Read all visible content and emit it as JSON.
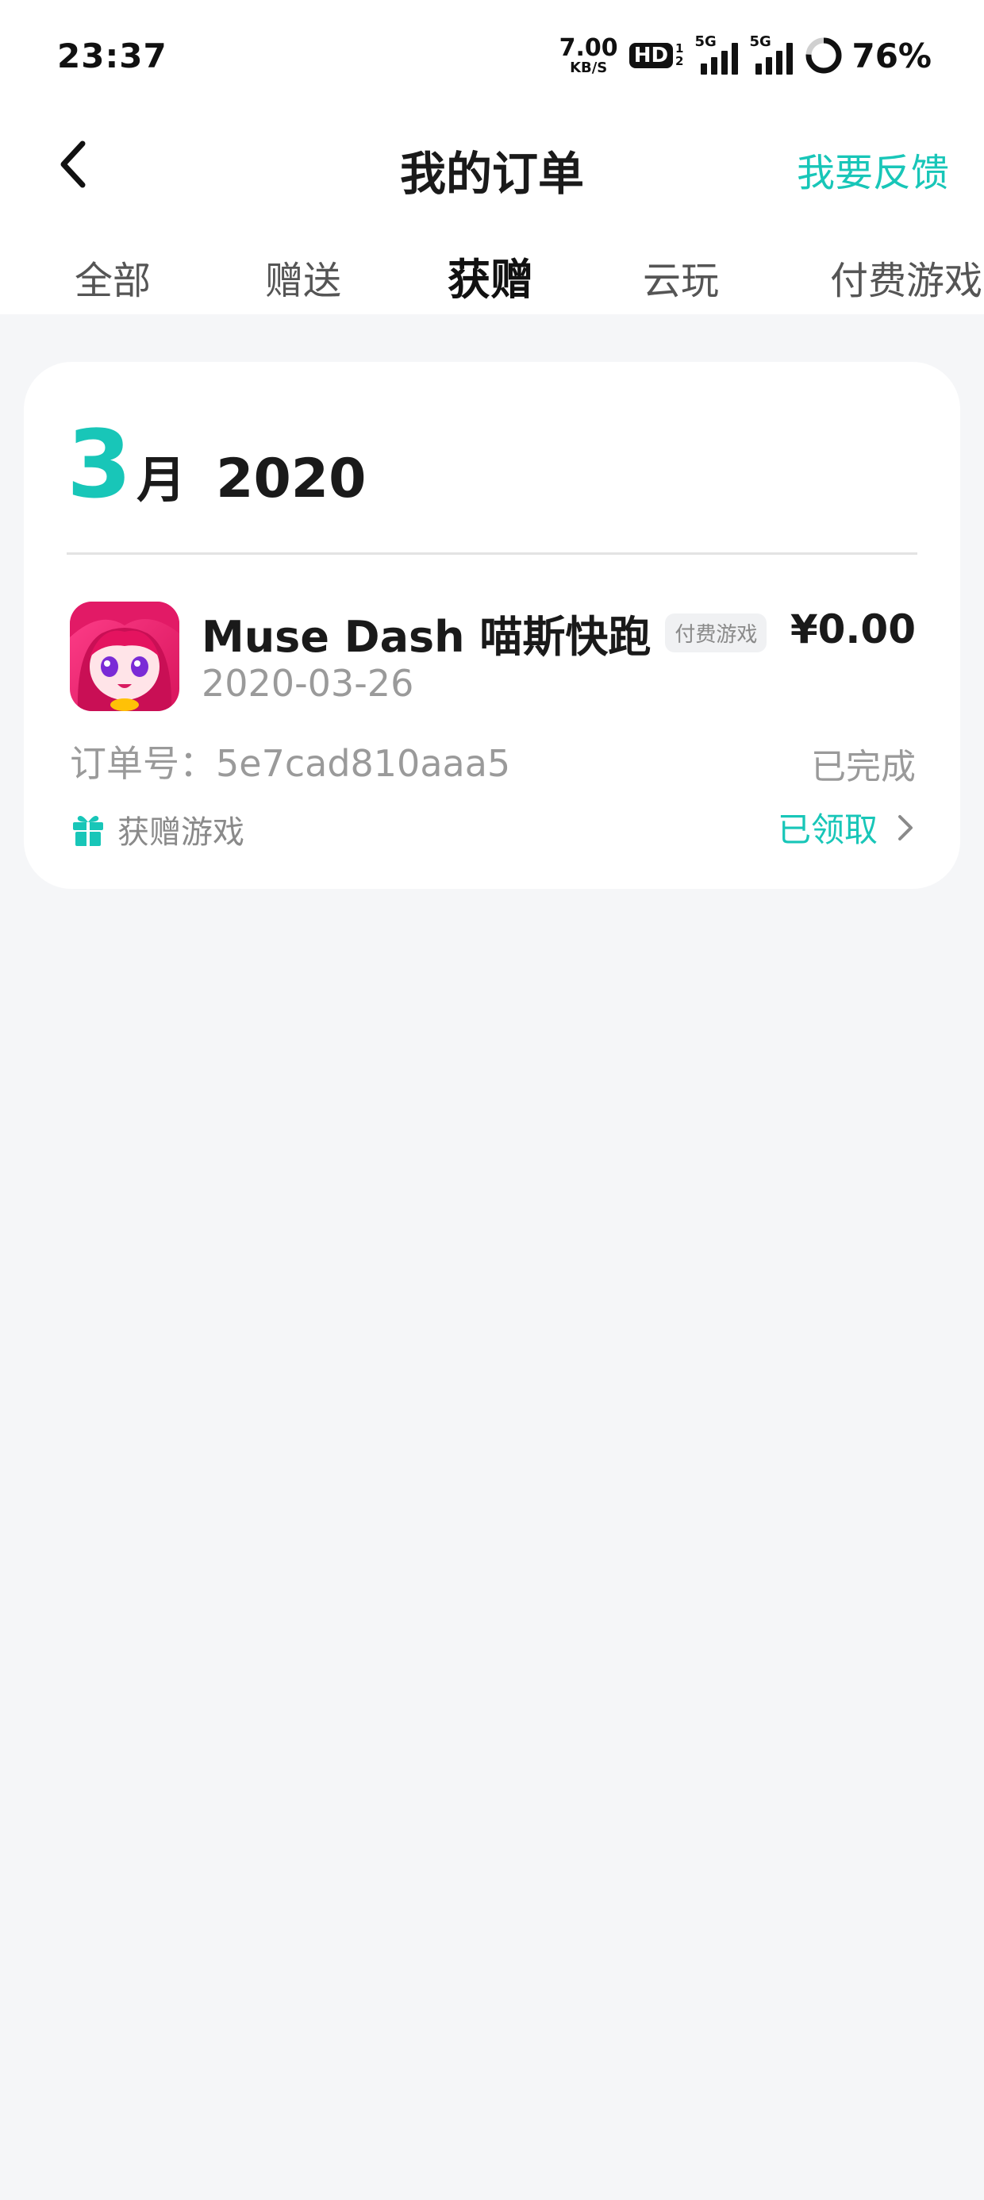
{
  "status_bar": {
    "time": "23:37",
    "net_speed_value": "7.00",
    "net_speed_unit": "KB/S",
    "hd_label": "HD",
    "hd_sub_1": "1",
    "hd_sub_2": "2",
    "signal_1_tag": "5G",
    "signal_2_tag": "5G",
    "battery_percent": "76%",
    "battery_level": 0.76
  },
  "header": {
    "title": "我的订单",
    "feedback_label": "我要反馈",
    "back_icon": "chevron-left-icon"
  },
  "tabs": [
    {
      "label": "全部"
    },
    {
      "label": "赠送"
    },
    {
      "label": "获赠",
      "active": true
    },
    {
      "label": "云玩"
    },
    {
      "label": "付费游戏"
    }
  ],
  "order_group": {
    "month_number": "3",
    "month_unit": "月",
    "year": "2020",
    "order": {
      "game_name": "Muse Dash 喵斯快跑",
      "game_tag": "付费游戏",
      "price": "¥0.00",
      "date": "2020-03-26",
      "order_number_label": "订单号：5e7cad810aaa5",
      "status": "已完成",
      "gift_label": "获赠游戏",
      "claim_status": "已领取"
    }
  },
  "colors": {
    "accent": "#18c6b8",
    "background": "#f5f6f8"
  }
}
